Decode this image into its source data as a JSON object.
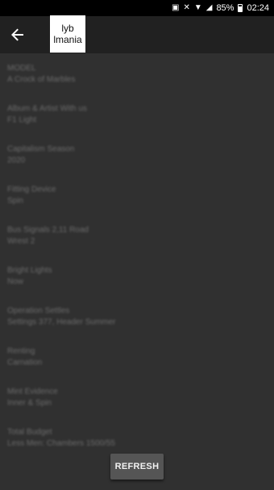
{
  "status_bar": {
    "battery_percent": "85%",
    "time": "02:24"
  },
  "app_bar": {
    "back_icon": "arrow-left-icon",
    "title_line1": "lyb",
    "title_line2": "lmania"
  },
  "items": [
    {
      "label": "MODEL",
      "value": "A Crock of Marbles"
    },
    {
      "label": "Album & Artist With us",
      "value": "F1 Light"
    },
    {
      "label": "Capitalism Season",
      "value": "2020"
    },
    {
      "label": "Fitting Device",
      "value": "Spin"
    },
    {
      "label": "Bus Signals 2,11 Road",
      "value": "Wrest 2"
    },
    {
      "label": "Bright Lights",
      "value": "Now"
    },
    {
      "label": "Operation Settles",
      "value": "Settings 377, Header Summer"
    },
    {
      "label": "Renting",
      "value": "Carnation"
    },
    {
      "label": "Mint Evidence",
      "value": "Inner & Spin"
    },
    {
      "label": "Total Budget",
      "value": "Less Men: Chambers 1500/55"
    }
  ],
  "refresh_button": {
    "label": "REFRESH"
  }
}
